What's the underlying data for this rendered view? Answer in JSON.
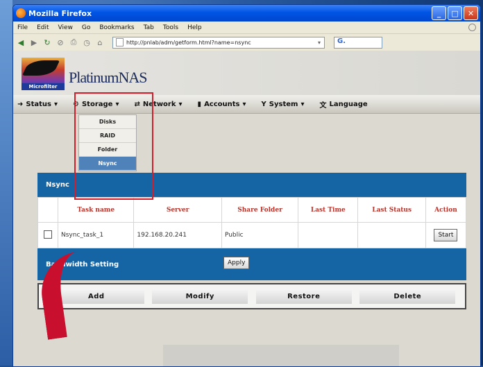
{
  "window": {
    "title": "Mozilla Firefox",
    "min": "_",
    "max": "□",
    "close": "✕"
  },
  "menubar": [
    "File",
    "Edit",
    "View",
    "Go",
    "Bookmarks",
    "Tab",
    "Tools",
    "Help"
  ],
  "navbar": {
    "url": "http://pnlab/adm/getform.html?name=nsync",
    "search_label": "G."
  },
  "header": {
    "brand": "PlatinumNAS",
    "logo_caption": "Microfilter"
  },
  "appmenu": [
    {
      "label": "Status",
      "icon": "status-icon"
    },
    {
      "label": "Storage",
      "icon": "gear-icon"
    },
    {
      "label": "Network",
      "icon": "network-icon"
    },
    {
      "label": "Accounts",
      "icon": "accounts-icon"
    },
    {
      "label": "System",
      "icon": "system-icon"
    },
    {
      "label": "Language",
      "icon": "language-icon"
    }
  ],
  "dropdown": {
    "items": [
      "Disks",
      "RAID",
      "Folder",
      "Nsync"
    ],
    "active": "Nsync"
  },
  "panel": {
    "title": "Nsync",
    "columns": [
      "Task name",
      "Server",
      "Share Folder",
      "Last Time",
      "Last Status",
      "Action"
    ],
    "rows": [
      {
        "task": "Nsync_task_1",
        "server": "192.168.20.241",
        "share": "Public",
        "last_time": "",
        "last_status": "",
        "action": "Start"
      }
    ],
    "bandwidth_label": "Bandwidth Setting",
    "apply_label": "Apply"
  },
  "actions": [
    "Add",
    "Modify",
    "Restore",
    "Delete"
  ],
  "colors": {
    "accent": "#1565a5",
    "highlight": "#d31d2a",
    "header_text": "#b5332a"
  }
}
